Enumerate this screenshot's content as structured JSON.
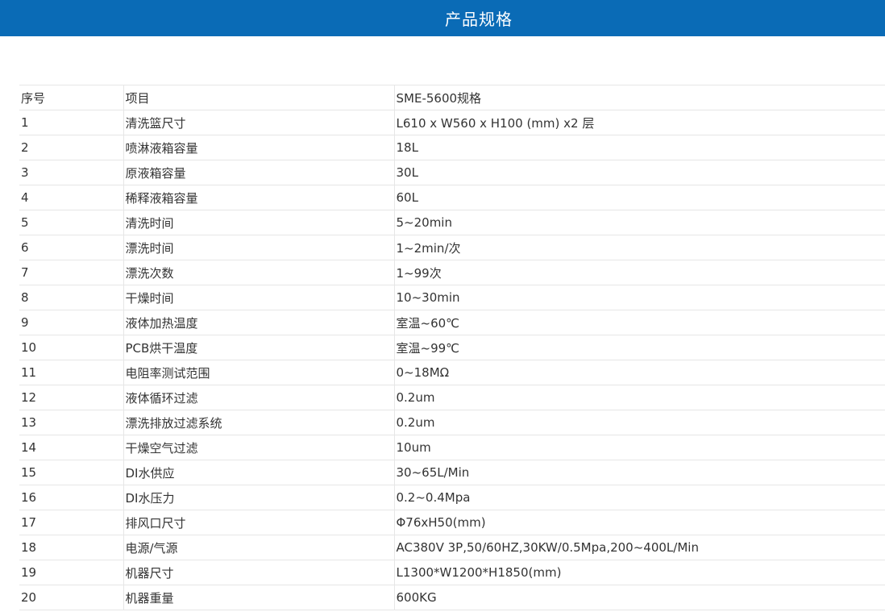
{
  "header": {
    "title": "产品规格"
  },
  "table": {
    "headers": [
      "序号",
      "项目",
      "SME-5600规格"
    ],
    "rows": [
      [
        "1",
        "清洗篮尺寸",
        "L610 x W560 x H100 (mm) x2 层"
      ],
      [
        "2",
        "喷淋液箱容量",
        "18L"
      ],
      [
        "3",
        "原液箱容量",
        "30L"
      ],
      [
        "4",
        "稀释液箱容量",
        "60L"
      ],
      [
        "5",
        "清洗时间",
        "5~20min"
      ],
      [
        "6",
        "漂洗时间",
        "1~2min/次"
      ],
      [
        "7",
        "漂洗次数",
        "1~99次"
      ],
      [
        "8",
        "干燥时间",
        "10~30min"
      ],
      [
        "9",
        "液体加热温度",
        "室温~60℃"
      ],
      [
        "10",
        "PCB烘干温度",
        "室温~99℃"
      ],
      [
        "11",
        "电阻率测试范围",
        "0~18MΩ"
      ],
      [
        "12",
        "液体循环过滤",
        "0.2um"
      ],
      [
        "13",
        "漂洗排放过滤系统",
        "0.2um"
      ],
      [
        "14",
        "干燥空气过滤",
        "10um"
      ],
      [
        "15",
        "DI水供应",
        "30~65L/Min"
      ],
      [
        "16",
        "DI水压力",
        "0.2~0.4Mpa"
      ],
      [
        "17",
        "排风口尺寸",
        "Φ76xH50(mm)"
      ],
      [
        "18",
        "电源/气源",
        "AC380V 3P,50/60HZ,30KW/0.5Mpa,200~400L/Min"
      ],
      [
        "19",
        "机器尺寸",
        "L1300*W1200*H1850(mm)"
      ],
      [
        "20",
        "机器重量",
        "600KG"
      ]
    ]
  },
  "colors": {
    "header_bg": "#0a6bb6",
    "header_text": "#ffffff",
    "border": "#e6e6e6",
    "text": "#333333"
  }
}
